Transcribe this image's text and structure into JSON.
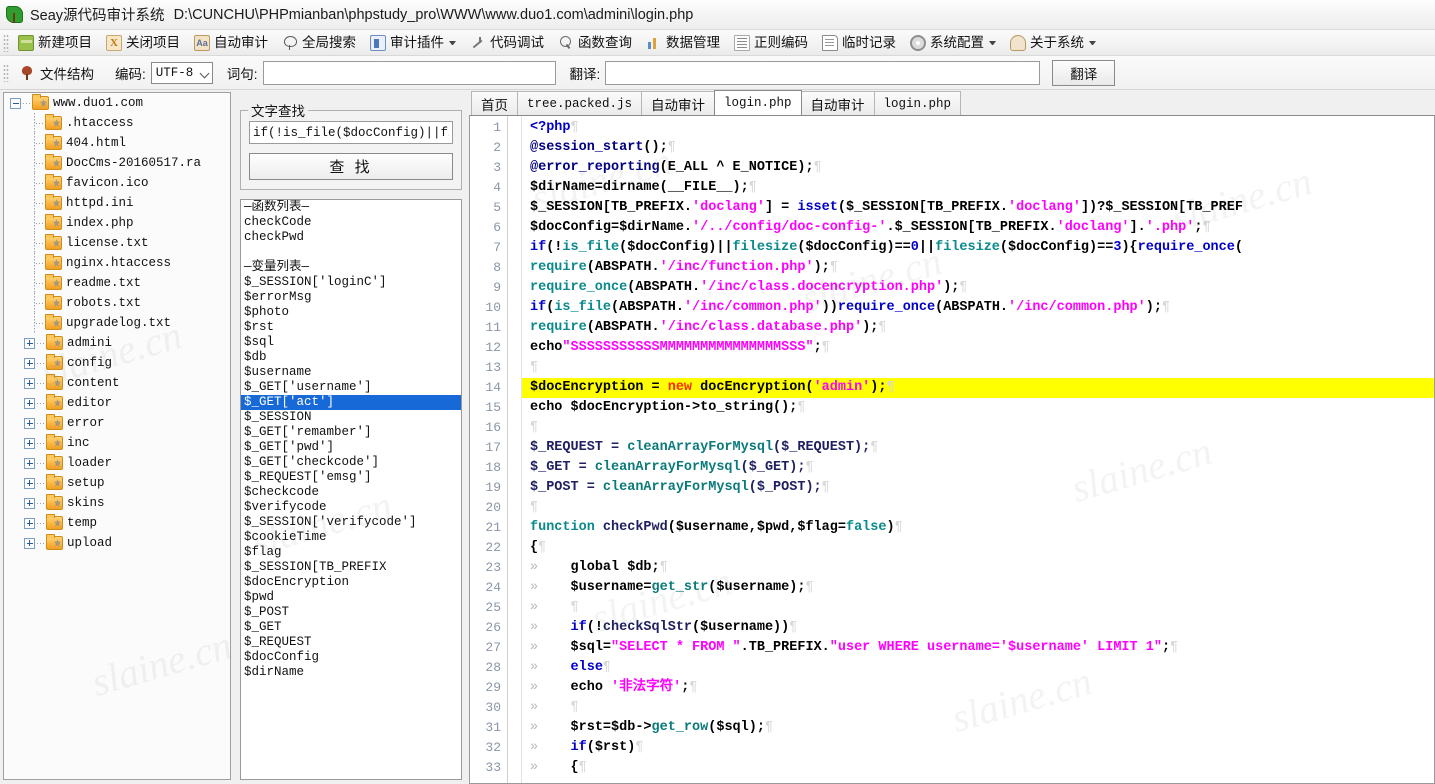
{
  "window": {
    "app_title": "Seay源代码审计系统",
    "file_path": "D:\\CUNCHU\\PHPmianban\\phpstudy_pro\\WWW\\www.duo1.com\\admini\\login.php",
    "app_icon": "seay-leaf-icon"
  },
  "toolbar": {
    "items": [
      {
        "label": "新建项目",
        "icon": "new-project-icon",
        "dropdown": false
      },
      {
        "label": "关闭项目",
        "icon": "close-project-icon",
        "dropdown": false
      },
      {
        "label": "自动审计",
        "icon": "auto-audit-icon",
        "dropdown": false
      },
      {
        "label": "全局搜索",
        "icon": "global-search-icon",
        "dropdown": false
      },
      {
        "label": "审计插件",
        "icon": "audit-plugin-icon",
        "dropdown": true
      },
      {
        "label": "代码调试",
        "icon": "code-debug-icon",
        "dropdown": false
      },
      {
        "label": "函数查询",
        "icon": "function-query-icon",
        "dropdown": false
      },
      {
        "label": "数据管理",
        "icon": "data-manage-icon",
        "dropdown": false
      },
      {
        "label": "正则编码",
        "icon": "regex-encode-icon",
        "dropdown": false
      },
      {
        "label": "临时记录",
        "icon": "temp-note-icon",
        "dropdown": false
      },
      {
        "label": "系统配置",
        "icon": "system-config-icon",
        "dropdown": true
      },
      {
        "label": "关于系统",
        "icon": "about-system-icon",
        "dropdown": true
      }
    ]
  },
  "toolbar2": {
    "structure_label": "文件结构",
    "encoding_label": "编码:",
    "encoding_value": "UTF-8",
    "word_label": "词句:",
    "word_value": "",
    "word_placeholder": "",
    "translate_label": "翻译:",
    "translate_value": "",
    "translate_placeholder": "",
    "translate_button": "翻译"
  },
  "tree": {
    "root": {
      "label": "www.duo1.com",
      "expanded": true
    },
    "files": [
      ".htaccess",
      "404.html",
      "DocCms-20160517.ra",
      "favicon.ico",
      "httpd.ini",
      "index.php",
      "license.txt",
      "nginx.htaccess",
      "readme.txt",
      "robots.txt",
      "upgradelog.txt"
    ],
    "folders": [
      "admini",
      "config",
      "content",
      "editor",
      "error",
      "inc",
      "loader",
      "setup",
      "skins",
      "temp",
      "upload"
    ]
  },
  "find_panel": {
    "legend": "文字查找",
    "input_value": "if(!is_file($docConfig)||fil",
    "button_label": "查 找"
  },
  "symbols": {
    "selected_index": 13,
    "items": [
      "—函数列表—",
      "checkCode",
      "checkPwd",
      "",
      "—变量列表—",
      "$_SESSION['loginC']",
      "$errorMsg",
      "$photo",
      "$rst",
      "$sql",
      "$db",
      "$username",
      "$_GET['username']",
      "$_GET['act']",
      "$_SESSION",
      "$_GET['remamber']",
      "$_GET['pwd']",
      "$_GET['checkcode']",
      "$_REQUEST['emsg']",
      "$checkcode",
      "$verifycode",
      "$_SESSION['verifycode']",
      "$cookieTime",
      "$flag",
      "$_SESSION[TB_PREFIX",
      "$docEncryption",
      "$pwd",
      "$_POST",
      "$_GET",
      "$_REQUEST",
      "$docConfig",
      "$dirName"
    ]
  },
  "tabs": {
    "active_index": 3,
    "items": [
      {
        "label": "首页",
        "mono": false
      },
      {
        "label": "tree.packed.js",
        "mono": true
      },
      {
        "label": "自动审计",
        "mono": false
      },
      {
        "label": "login.php",
        "mono": true
      },
      {
        "label": "自动审计",
        "mono": false
      },
      {
        "label": "login.php",
        "mono": true
      }
    ]
  },
  "editor": {
    "highlight_line": 14,
    "first_line": 1,
    "last_line": 33,
    "lines": [
      {
        "n": 1,
        "tokens": [
          {
            "t": "<?php",
            "c": "kw"
          },
          {
            "t": "¶",
            "c": "pilcrow"
          }
        ]
      },
      {
        "n": 2,
        "tokens": [
          {
            "t": "@session_start",
            "c": "op"
          },
          {
            "t": "();",
            "c": "pl"
          },
          {
            "t": "¶",
            "c": "pilcrow"
          }
        ]
      },
      {
        "n": 3,
        "tokens": [
          {
            "t": "@error_reporting",
            "c": "op"
          },
          {
            "t": "(E_ALL ^ E_NOTICE);",
            "c": "pl"
          },
          {
            "t": "¶",
            "c": "pilcrow"
          }
        ]
      },
      {
        "n": 4,
        "tokens": [
          {
            "t": "$dirName=dirname(__FILE__);",
            "c": "pl"
          },
          {
            "t": "¶",
            "c": "pilcrow"
          }
        ]
      },
      {
        "n": 5,
        "tokens": [
          {
            "t": "$_SESSION[TB_PREFIX.",
            "c": "pl"
          },
          {
            "t": "'doclang'",
            "c": "str"
          },
          {
            "t": "] = ",
            "c": "pl"
          },
          {
            "t": "isset",
            "c": "kw"
          },
          {
            "t": "($_SESSION[TB_PREFIX.",
            "c": "pl"
          },
          {
            "t": "'doclang'",
            "c": "str"
          },
          {
            "t": "])?$_SESSION[TB_PREF",
            "c": "pl"
          }
        ]
      },
      {
        "n": 6,
        "tokens": [
          {
            "t": "$docConfig=$dirName.",
            "c": "pl"
          },
          {
            "t": "'/../config/doc-config-'",
            "c": "str"
          },
          {
            "t": ".$_SESSION[TB_PREFIX.",
            "c": "pl"
          },
          {
            "t": "'doclang'",
            "c": "str"
          },
          {
            "t": "].",
            "c": "pl"
          },
          {
            "t": "'.php'",
            "c": "str"
          },
          {
            "t": ";",
            "c": "pl"
          },
          {
            "t": "¶",
            "c": "pilcrow"
          }
        ]
      },
      {
        "n": 7,
        "tokens": [
          {
            "t": "if",
            "c": "kw"
          },
          {
            "t": "(!",
            "c": "pl"
          },
          {
            "t": "is_file",
            "c": "kw2"
          },
          {
            "t": "($docConfig)||",
            "c": "pl"
          },
          {
            "t": "filesize",
            "c": "kw2"
          },
          {
            "t": "($docConfig)==",
            "c": "pl"
          },
          {
            "t": "0",
            "c": "num"
          },
          {
            "t": "||",
            "c": "pl"
          },
          {
            "t": "filesize",
            "c": "kw2"
          },
          {
            "t": "($docConfig)==",
            "c": "pl"
          },
          {
            "t": "3",
            "c": "num"
          },
          {
            "t": "){",
            "c": "pl"
          },
          {
            "t": "require_once",
            "c": "kw"
          },
          {
            "t": "(",
            "c": "pl"
          }
        ]
      },
      {
        "n": 8,
        "tokens": [
          {
            "t": "require",
            "c": "kw2"
          },
          {
            "t": "(ABSPATH.",
            "c": "pl"
          },
          {
            "t": "'/inc/function.php'",
            "c": "str"
          },
          {
            "t": ");",
            "c": "pl"
          },
          {
            "t": "¶",
            "c": "pilcrow"
          }
        ]
      },
      {
        "n": 9,
        "tokens": [
          {
            "t": "require_once",
            "c": "kw2"
          },
          {
            "t": "(ABSPATH.",
            "c": "pl"
          },
          {
            "t": "'/inc/class.docencryption.php'",
            "c": "str"
          },
          {
            "t": ");",
            "c": "pl"
          },
          {
            "t": "¶",
            "c": "pilcrow"
          }
        ]
      },
      {
        "n": 10,
        "tokens": [
          {
            "t": "if",
            "c": "kw"
          },
          {
            "t": "(",
            "c": "pl"
          },
          {
            "t": "is_file",
            "c": "kw2"
          },
          {
            "t": "(ABSPATH.",
            "c": "pl"
          },
          {
            "t": "'/inc/common.php'",
            "c": "str"
          },
          {
            "t": "))",
            "c": "pl"
          },
          {
            "t": "require_once",
            "c": "kw"
          },
          {
            "t": "(ABSPATH.",
            "c": "pl"
          },
          {
            "t": "'/inc/common.php'",
            "c": "str"
          },
          {
            "t": ");",
            "c": "pl"
          },
          {
            "t": "¶",
            "c": "pilcrow"
          }
        ]
      },
      {
        "n": 11,
        "tokens": [
          {
            "t": "require",
            "c": "kw2"
          },
          {
            "t": "(ABSPATH.",
            "c": "pl"
          },
          {
            "t": "'/inc/class.database.php'",
            "c": "str"
          },
          {
            "t": ");",
            "c": "pl"
          },
          {
            "t": "¶",
            "c": "pilcrow"
          }
        ]
      },
      {
        "n": 12,
        "tokens": [
          {
            "t": "echo",
            "c": "pl"
          },
          {
            "t": "\"SSSSSSSSSSSMMMMMMMMMMMMMMMSSS\"",
            "c": "str"
          },
          {
            "t": ";",
            "c": "pl"
          },
          {
            "t": "¶",
            "c": "pilcrow"
          }
        ]
      },
      {
        "n": 13,
        "tokens": [
          {
            "t": "¶",
            "c": "pilcrow"
          }
        ]
      },
      {
        "n": 14,
        "tokens": [
          {
            "t": "$docEncryption = ",
            "c": "pl"
          },
          {
            "t": "new",
            "c": "new"
          },
          {
            "t": " docEncryption(",
            "c": "pl"
          },
          {
            "t": "'admin'",
            "c": "str"
          },
          {
            "t": ");",
            "c": "pl"
          },
          {
            "t": "¶",
            "c": "pilcrow"
          }
        ]
      },
      {
        "n": 15,
        "tokens": [
          {
            "t": "echo $docEncryption->to_string();",
            "c": "pl"
          },
          {
            "t": "¶",
            "c": "pilcrow"
          }
        ]
      },
      {
        "n": 16,
        "tokens": [
          {
            "t": "¶",
            "c": "pilcrow"
          }
        ]
      },
      {
        "n": 17,
        "tokens": [
          {
            "t": "$_REQUEST = ",
            "c": "var"
          },
          {
            "t": "cleanArrayForMysql",
            "c": "fn"
          },
          {
            "t": "($_REQUEST);",
            "c": "var"
          },
          {
            "t": "¶",
            "c": "pilcrow"
          }
        ]
      },
      {
        "n": 18,
        "tokens": [
          {
            "t": "$_GET = ",
            "c": "var"
          },
          {
            "t": "cleanArrayForMysql",
            "c": "fn"
          },
          {
            "t": "($_GET);",
            "c": "var"
          },
          {
            "t": "¶",
            "c": "pilcrow"
          }
        ]
      },
      {
        "n": 19,
        "tokens": [
          {
            "t": "$_POST = ",
            "c": "var"
          },
          {
            "t": "cleanArrayForMysql",
            "c": "fn"
          },
          {
            "t": "($_POST);",
            "c": "var"
          },
          {
            "t": "¶",
            "c": "pilcrow"
          }
        ]
      },
      {
        "n": 20,
        "tokens": [
          {
            "t": "¶",
            "c": "pilcrow"
          }
        ]
      },
      {
        "n": 21,
        "tokens": [
          {
            "t": "function",
            "c": "kw2"
          },
          {
            "t": " ",
            "c": "pl"
          },
          {
            "t": "checkPwd",
            "c": "var"
          },
          {
            "t": "($username,$pwd,$flag=",
            "c": "pl"
          },
          {
            "t": "false",
            "c": "kw2"
          },
          {
            "t": ")",
            "c": "pl"
          },
          {
            "t": "¶",
            "c": "pilcrow"
          }
        ]
      },
      {
        "n": 22,
        "tokens": [
          {
            "t": "{",
            "c": "pl"
          },
          {
            "t": "¶",
            "c": "pilcrow"
          }
        ]
      },
      {
        "n": 23,
        "tokens": [
          {
            "t": "»",
            "c": "arrow"
          },
          {
            "t": "    global",
            "c": "pl"
          },
          {
            "t": " $db;",
            "c": "pl"
          },
          {
            "t": "¶",
            "c": "pilcrow"
          }
        ]
      },
      {
        "n": 24,
        "tokens": [
          {
            "t": "»",
            "c": "arrow"
          },
          {
            "t": "    $username=",
            "c": "pl"
          },
          {
            "t": "get_str",
            "c": "fn"
          },
          {
            "t": "($username);",
            "c": "pl"
          },
          {
            "t": "¶",
            "c": "pilcrow"
          }
        ]
      },
      {
        "n": 25,
        "tokens": [
          {
            "t": "»",
            "c": "arrow"
          },
          {
            "t": "    ",
            "c": "pl"
          },
          {
            "t": "¶",
            "c": "pilcrow"
          }
        ]
      },
      {
        "n": 26,
        "tokens": [
          {
            "t": "»",
            "c": "arrow"
          },
          {
            "t": "    ",
            "c": "pl"
          },
          {
            "t": "if",
            "c": "kw"
          },
          {
            "t": "(!",
            "c": "pl"
          },
          {
            "t": "checkSqlStr",
            "c": "var"
          },
          {
            "t": "($username))",
            "c": "pl"
          },
          {
            "t": "¶",
            "c": "pilcrow"
          }
        ]
      },
      {
        "n": 27,
        "tokens": [
          {
            "t": "»",
            "c": "arrow"
          },
          {
            "t": "    $sql=",
            "c": "pl"
          },
          {
            "t": "\"SELECT * FROM \"",
            "c": "str"
          },
          {
            "t": ".TB_PREFIX.",
            "c": "pl"
          },
          {
            "t": "\"user WHERE username='$username' LIMIT 1\"",
            "c": "str"
          },
          {
            "t": ";",
            "c": "pl"
          },
          {
            "t": "¶",
            "c": "pilcrow"
          }
        ]
      },
      {
        "n": 28,
        "tokens": [
          {
            "t": "»",
            "c": "arrow"
          },
          {
            "t": "    ",
            "c": "pl"
          },
          {
            "t": "else",
            "c": "kw"
          },
          {
            "t": "¶",
            "c": "pilcrow"
          }
        ]
      },
      {
        "n": 29,
        "tokens": [
          {
            "t": "»",
            "c": "arrow"
          },
          {
            "t": "    echo ",
            "c": "pl"
          },
          {
            "t": "'非法字符'",
            "c": "str"
          },
          {
            "t": ";",
            "c": "pl"
          },
          {
            "t": "¶",
            "c": "pilcrow"
          }
        ]
      },
      {
        "n": 30,
        "tokens": [
          {
            "t": "»",
            "c": "arrow"
          },
          {
            "t": "    ",
            "c": "pl"
          },
          {
            "t": "¶",
            "c": "pilcrow"
          }
        ]
      },
      {
        "n": 31,
        "tokens": [
          {
            "t": "»",
            "c": "arrow"
          },
          {
            "t": "    $rst=$db->",
            "c": "pl"
          },
          {
            "t": "get_row",
            "c": "fn"
          },
          {
            "t": "($sql);",
            "c": "pl"
          },
          {
            "t": "¶",
            "c": "pilcrow"
          }
        ]
      },
      {
        "n": 32,
        "tokens": [
          {
            "t": "»",
            "c": "arrow"
          },
          {
            "t": "    ",
            "c": "pl"
          },
          {
            "t": "if",
            "c": "kw"
          },
          {
            "t": "($rst)",
            "c": "pl"
          },
          {
            "t": "¶",
            "c": "pilcrow"
          }
        ]
      },
      {
        "n": 33,
        "tokens": [
          {
            "t": "»",
            "c": "arrow"
          },
          {
            "t": "    {",
            "c": "pl"
          },
          {
            "t": "¶",
            "c": "pilcrow"
          }
        ]
      }
    ]
  },
  "colors": {
    "highlight": "#ffff00",
    "selection": "#1669d6",
    "keyword": "#0000c8",
    "string": "#ff00ff",
    "function": "#0a7a7a",
    "new_keyword": "#ff2a00"
  }
}
